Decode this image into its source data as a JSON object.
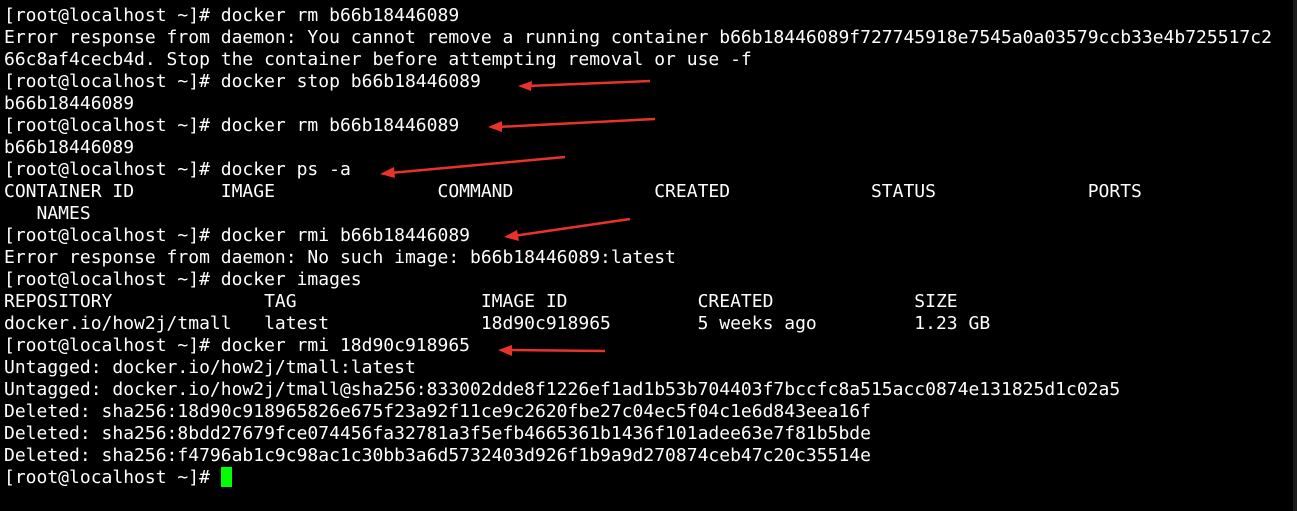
{
  "colors": {
    "background": "#000000",
    "text": "#ffffff",
    "cursor": "#00ff00",
    "arrow": "#e8322a"
  },
  "terminal": {
    "prompt": "[root@localhost ~]#",
    "cursor_icon": "block-cursor",
    "arrow_icon": "red-arrow-annotation",
    "lines": [
      "[root@localhost ~]# docker rm b66b18446089",
      "Error response from daemon: You cannot remove a running container b66b18446089f727745918e7545a0a03579ccb33e4b725517c2",
      "66c8af4cecb4d. Stop the container before attempting removal or use -f",
      "[root@localhost ~]# docker stop b66b18446089",
      "b66b18446089",
      "[root@localhost ~]# docker rm b66b18446089",
      "b66b18446089",
      "[root@localhost ~]# docker ps -a",
      "CONTAINER ID        IMAGE               COMMAND             CREATED             STATUS              PORTS",
      "   NAMES",
      "[root@localhost ~]# docker rmi b66b18446089",
      "Error response from daemon: No such image: b66b18446089:latest",
      "[root@localhost ~]# docker images",
      "REPOSITORY              TAG                 IMAGE ID            CREATED             SIZE",
      "docker.io/how2j/tmall   latest              18d90c918965        5 weeks ago         1.23 GB",
      "[root@localhost ~]# docker rmi 18d90c918965",
      "Untagged: docker.io/how2j/tmall:latest",
      "Untagged: docker.io/how2j/tmall@sha256:833002dde8f1226ef1ad1b53b704403f7bccfc8a515acc0874e131825d1c02a5",
      "Deleted: sha256:18d90c918965826e675f23a92f11ce9c2620fbe27c04ec5f04c1e6d843eea16f",
      "Deleted: sha256:8bdd27679fce074456fa32781a3f5efb4665361b1436f101adee63e7f81b5bde",
      "Deleted: sha256:f4796ab1c9c98ac1c30bb3a6d5732403d926f1b9a9d270874ceb47c20c35514e",
      "[root@localhost ~]#"
    ]
  }
}
